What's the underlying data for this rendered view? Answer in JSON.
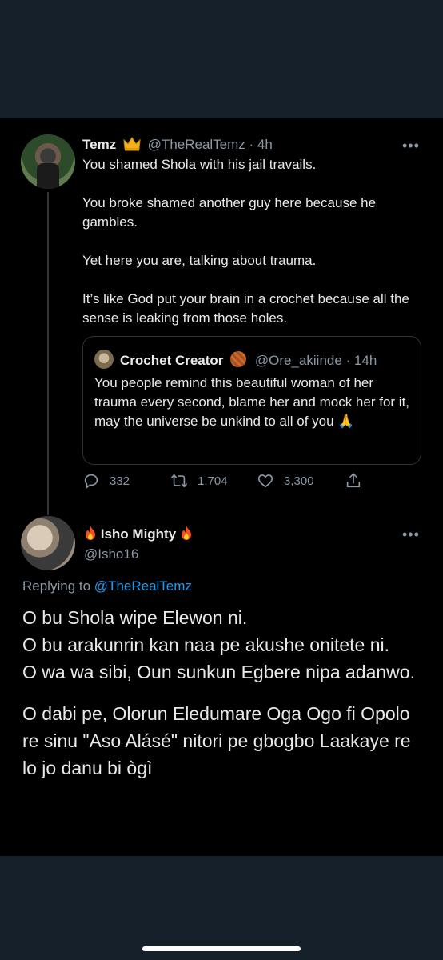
{
  "tweet1": {
    "name": "Temz",
    "handle": "@TheRealTemz",
    "time": "· 4h",
    "more": "•••",
    "body": [
      "You shamed Shola with his jail travails.",
      "You broke shamed another guy here because he gambles.",
      "Yet here you are, talking about trauma.",
      "It’s like God put your brain in a crochet because all the sense is leaking from those holes."
    ],
    "quote": {
      "name": "Crochet Creator",
      "handle": "@Ore_akiinde",
      "time": "· 14h",
      "body": "You people remind this beautiful woman of her trauma every second, blame her and mock her for it, may the universe be unkind to all of you 🙏"
    },
    "actions": {
      "replies": "332",
      "retweets": "1,704",
      "likes": "3,300"
    },
    "icons": [
      "crown-icon",
      "yarn-icon",
      "reply-icon",
      "retweet-icon",
      "like-icon",
      "share-icon",
      "more-icon"
    ]
  },
  "tweet2": {
    "name": "Isho Mighty",
    "handle": "@Isho16",
    "more": "•••",
    "replying_prefix": "Replying to",
    "replying_to": "@TheRealTemz",
    "body": [
      "O bu Shola wipe Elewon ni.",
      "O bu arakunrin kan naa pe akushe onitete ni.",
      "O wa wa sibi, Oun sunkun Egbere nipa adanwo.",
      "O dabi pe, Olorun Eledumare Oga Ogo fi Opolo re sinu \"Aso Alásé\" nitori pe gbogbo Laakaye re lo jo danu bi ògì"
    ],
    "icons": [
      "fire-icon"
    ]
  },
  "colors": {
    "background_dark": "#15202b",
    "tweet_background": "#000000",
    "text": "#e7e9ea",
    "muted": "#8b98a5",
    "link": "#1d9bf0"
  }
}
